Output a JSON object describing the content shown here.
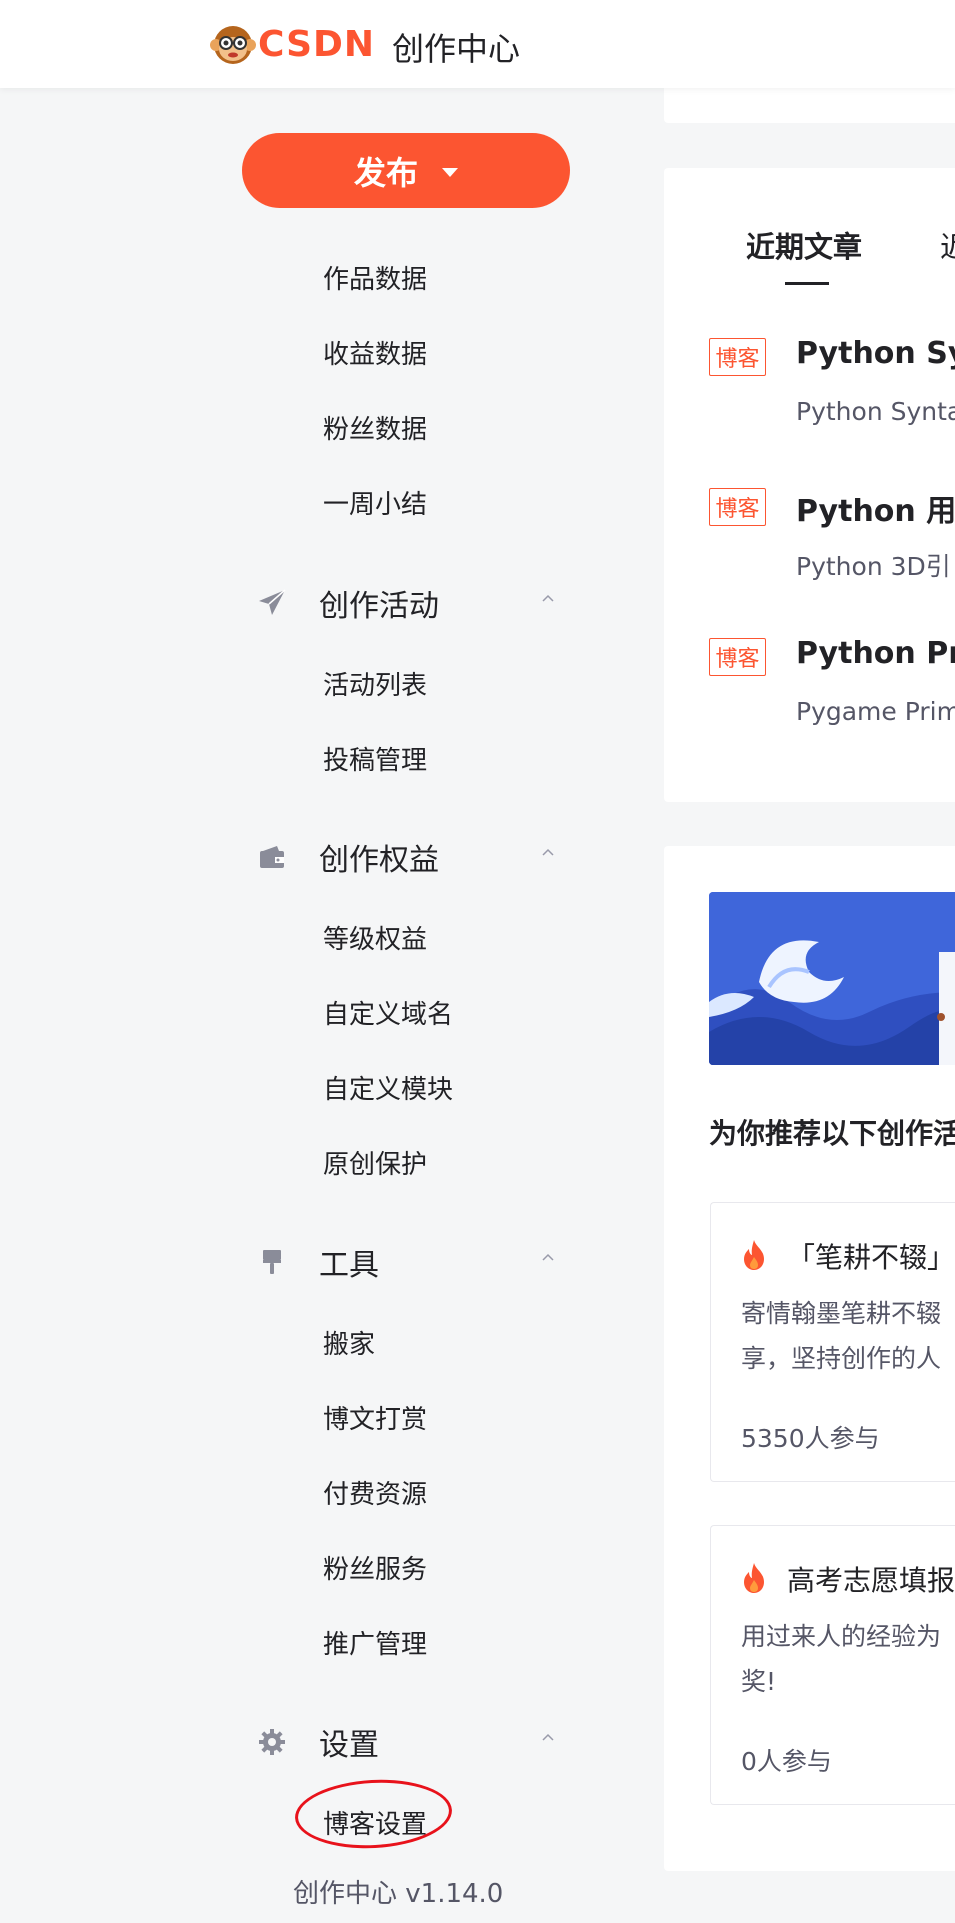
{
  "header": {
    "logo_text": "CSDN",
    "title": "创作中心"
  },
  "sidebar": {
    "publish_label": "发布",
    "data_items": [
      "作品数据",
      "收益数据",
      "粉丝数据",
      "一周小结"
    ],
    "groups": [
      {
        "label": "创作活动",
        "icon": "paper-plane-icon",
        "items": [
          "活动列表",
          "投稿管理"
        ]
      },
      {
        "label": "创作权益",
        "icon": "wallet-icon",
        "items": [
          "等级权益",
          "自定义域名",
          "自定义模块",
          "原创保护"
        ]
      },
      {
        "label": "工具",
        "icon": "brush-icon",
        "items": [
          "搬家",
          "博文打赏",
          "付费资源",
          "粉丝服务",
          "推广管理"
        ]
      },
      {
        "label": "设置",
        "icon": "gear-icon",
        "items": [
          "博客设置"
        ]
      }
    ],
    "version": "创作中心 v1.14.0"
  },
  "articles": {
    "tab_active": "近期文章",
    "tab_next": "近",
    "items": [
      {
        "tag": "博客",
        "title": "Python Sy",
        "desc": "Python Synta"
      },
      {
        "tag": "博客",
        "title": "Python 用U",
        "desc": "Python 3D引"
      },
      {
        "tag": "博客",
        "title": "Python Pri",
        "desc": "Pygame Prim"
      }
    ]
  },
  "activities": {
    "recommend_title": "为你推荐以下创作活",
    "items": [
      {
        "title": "「笔耕不辍」",
        "desc": "寄情翰墨笔耕不辍\n享，坚持创作的人",
        "count": "5350人参与"
      },
      {
        "title": "高考志愿填报",
        "desc": "用过来人的经验为\n奖!",
        "count": "0人参与"
      }
    ]
  },
  "colors": {
    "brand": "#fc5531",
    "annotation_circle": "#e8121b",
    "banner": "#3d63d8"
  }
}
